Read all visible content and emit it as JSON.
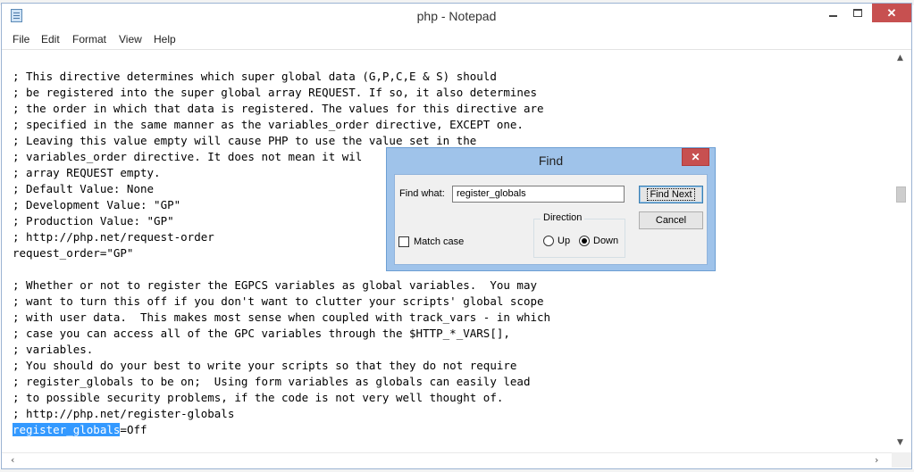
{
  "window": {
    "title": "php - Notepad",
    "close_glyph": "✕",
    "min_icon": "minimize-icon",
    "max_icon": "maximize-icon"
  },
  "menu": [
    "File",
    "Edit",
    "Format",
    "View",
    "Help"
  ],
  "editor": {
    "lines": [
      "",
      "; This directive determines which super global data (G,P,C,E & S) should",
      "; be registered into the super global array REQUEST. If so, it also determines",
      "; the order in which that data is registered. The values for this directive are",
      "; specified in the same manner as the variables_order directive, EXCEPT one.",
      "; Leaving this value empty will cause PHP to use the value set in the",
      "; variables_order directive. It does not mean it wil",
      "; array REQUEST empty.",
      "; Default Value: None",
      "; Development Value: \"GP\"",
      "; Production Value: \"GP\"",
      "; http://php.net/request-order",
      "request_order=\"GP\"",
      "",
      "; Whether or not to register the EGPCS variables as global variables.  You may",
      "; want to turn this off if you don't want to clutter your scripts' global scope",
      "; with user data.  This makes most sense when coupled with track_vars - in which",
      "; case you can access all of the GPC variables through the $HTTP_*_VARS[],",
      "; variables.",
      "; You should do your best to write your scripts so that they do not require",
      "; register_globals to be on;  Using form variables as globals can easily lead",
      "; to possible security problems, if the code is not very well thought of.",
      "; http://php.net/register-globals"
    ],
    "last_line": {
      "selected": "register_globals",
      "rest": "=Off"
    }
  },
  "find_dialog": {
    "title": "Find",
    "close_glyph": "✕",
    "find_what_label": "Find what:",
    "find_what_value": "register_globals",
    "find_next_label": "Find Next",
    "cancel_label": "Cancel",
    "direction_label": "Direction",
    "up_label": "Up",
    "down_label": "Down",
    "direction_selected": "Down",
    "match_case_label": "Match case",
    "match_case_checked": false
  },
  "colors": {
    "selection": "#3399ff",
    "close_button": "#c75050",
    "dialog_frame": "#9fc3ea"
  }
}
